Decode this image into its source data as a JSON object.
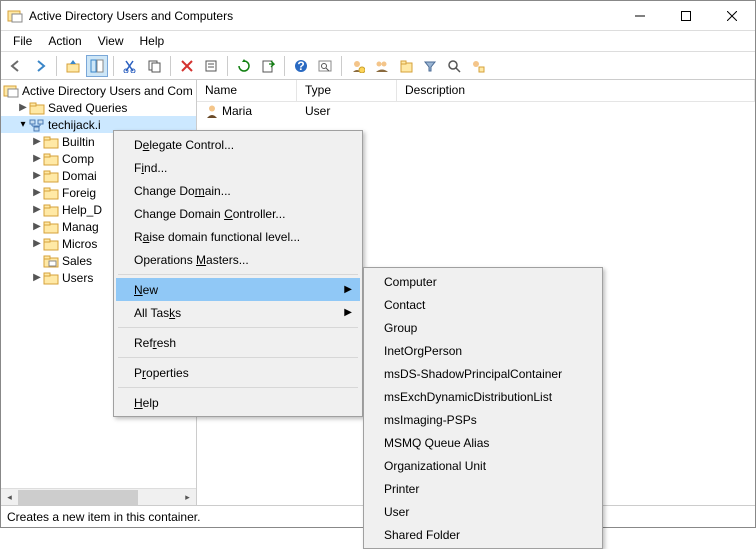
{
  "title": "Active Directory Users and Computers",
  "menubar": {
    "file": "File",
    "action": "Action",
    "view": "View",
    "help": "Help"
  },
  "tree": {
    "root": "Active Directory Users and Com",
    "saved_queries": "Saved Queries",
    "domain": "techijack.i",
    "children": {
      "builtin": "Builtin",
      "computers": "Comp",
      "domain_controllers": "Domai",
      "foreign": "Foreig",
      "helpdesk": "Help_D",
      "managed": "Manag",
      "microsoft": "Micros",
      "sales": "Sales",
      "users": "Users"
    }
  },
  "list": {
    "columns": {
      "name": "Name",
      "type": "Type",
      "description": "Description"
    },
    "row": {
      "name": "Maria",
      "type": "User",
      "description": ""
    }
  },
  "context_menu": {
    "delegate": "Delegate Control...",
    "find": "Find...",
    "change_domain": "Change Domain...",
    "change_dc": "Change Domain Controller...",
    "raise": "Raise domain functional level...",
    "opmasters": "Operations Masters...",
    "new": "New",
    "all_tasks": "All Tasks",
    "refresh": "Refresh",
    "properties": "Properties",
    "help": "Help"
  },
  "submenu": {
    "computer": "Computer",
    "contact": "Contact",
    "group": "Group",
    "inetorg": "InetOrgPerson",
    "msds": "msDS-ShadowPrincipalContainer",
    "msexch": "msExchDynamicDistributionList",
    "msimg": "msImaging-PSPs",
    "msmq": "MSMQ Queue Alias",
    "ou": "Organizational Unit",
    "printer": "Printer",
    "user": "User",
    "shared_folder": "Shared Folder"
  },
  "status": "Creates a new item in this container."
}
